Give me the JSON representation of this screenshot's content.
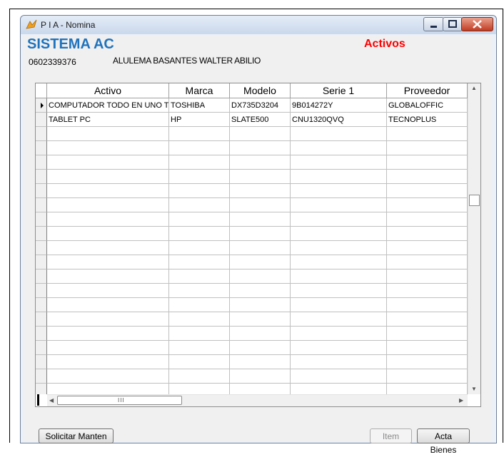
{
  "window": {
    "title": "P I A - Nomina"
  },
  "header": {
    "system_title": "SISTEMA AC",
    "section_label": "Activos",
    "user_id": "0602339376",
    "user_name": "ALULEMA BASANTES WALTER ABILIO"
  },
  "grid": {
    "columns": [
      "Activo",
      "Marca",
      "Modelo",
      "Serie 1",
      "Proveedor"
    ],
    "rows": [
      [
        "COMPUTADOR TODO EN UNO T",
        "TOSHIBA",
        "DX735D3204",
        "9B014272Y",
        "GLOBALOFFIC"
      ],
      [
        "TABLET PC",
        "HP",
        "SLATE500",
        "CNU1320QVQ",
        "TECNOPLUS"
      ]
    ],
    "selected_row": 0
  },
  "buttons": {
    "solicitar": "Solicitar Manten",
    "item": "Item",
    "acta": "Acta Bienes"
  },
  "colors": {
    "title_blue": "#1e73be",
    "activos_red": "#ff0000"
  }
}
